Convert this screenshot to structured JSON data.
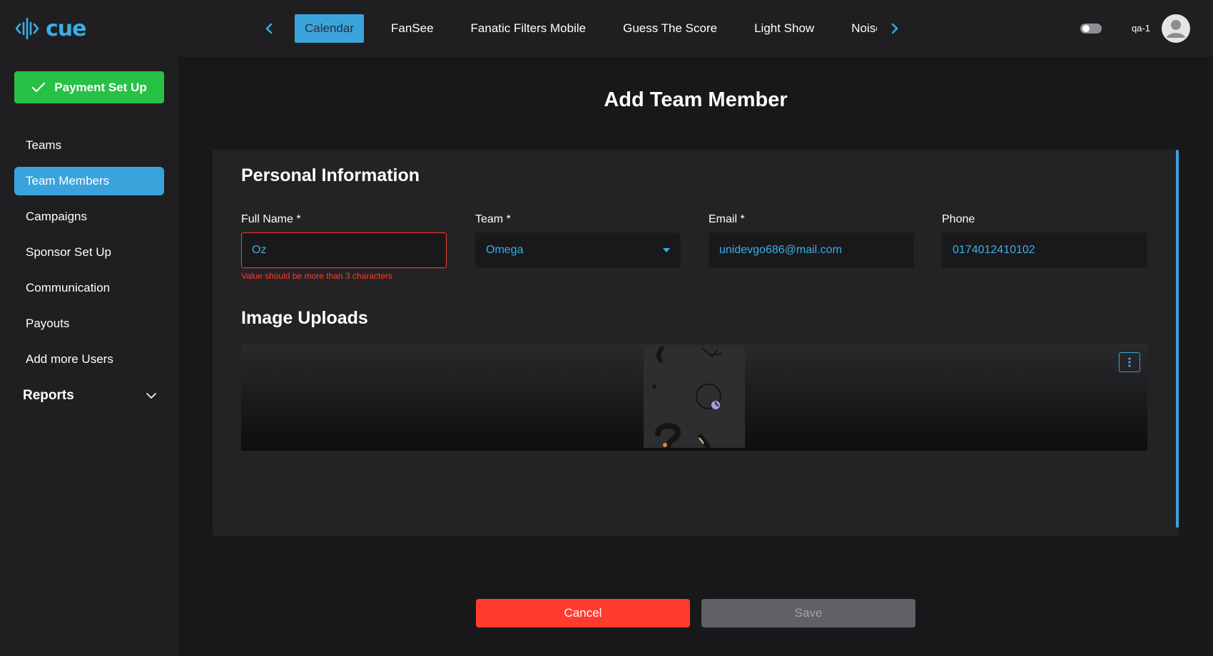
{
  "app": {
    "logo_text": "cue",
    "brand_color": "#3aaee8"
  },
  "topnav": {
    "tabs": [
      {
        "label": "Calendar",
        "active": true
      },
      {
        "label": "FanSee",
        "active": false
      },
      {
        "label": "Fanatic Filters Mobile",
        "active": false
      },
      {
        "label": "Guess The Score",
        "active": false
      },
      {
        "label": "Light Show",
        "active": false
      },
      {
        "label": "Noise",
        "active": false
      }
    ],
    "prev_icon": "chevron-left-icon",
    "next_icon": "chevron-right-icon",
    "theme_toggle_icon": "dark-mode-toggle-icon",
    "username": "qa-1",
    "avatar_icon": "user-avatar-icon"
  },
  "sidebar": {
    "payment_button": {
      "label": "Payment Set Up",
      "icon": "check-icon",
      "color": "#27c146"
    },
    "items": [
      {
        "label": "Teams",
        "active": false
      },
      {
        "label": "Team Members",
        "active": true
      },
      {
        "label": "Campaigns",
        "active": false
      },
      {
        "label": "Sponsor Set Up",
        "active": false
      },
      {
        "label": "Communication",
        "active": false
      },
      {
        "label": "Payouts",
        "active": false
      },
      {
        "label": "Add more Users",
        "active": false
      }
    ],
    "reports": {
      "label": "Reports",
      "icon": "chevron-down-icon"
    }
  },
  "main": {
    "title": "Add Team Member",
    "personal_info": {
      "title": "Personal Information",
      "fields": {
        "full_name": {
          "label": "Full Name *",
          "value": "Oz",
          "error": "Value should be more than 3 characters"
        },
        "team": {
          "label": "Team *",
          "value": "Omega",
          "icon": "caret-down-icon"
        },
        "email": {
          "label": "Email *",
          "value": "unidevgo686@mail.com"
        },
        "phone": {
          "label": "Phone",
          "value": "0174012410102"
        }
      }
    },
    "image_uploads": {
      "title": "Image Uploads",
      "menu_icon": "more-vertical-icon"
    },
    "actions": {
      "cancel_label": "Cancel",
      "save_label": "Save"
    }
  },
  "colors": {
    "accent": "#3aa3db",
    "error": "#ff3b30",
    "success": "#27c146",
    "disabled": "#5f6166"
  }
}
